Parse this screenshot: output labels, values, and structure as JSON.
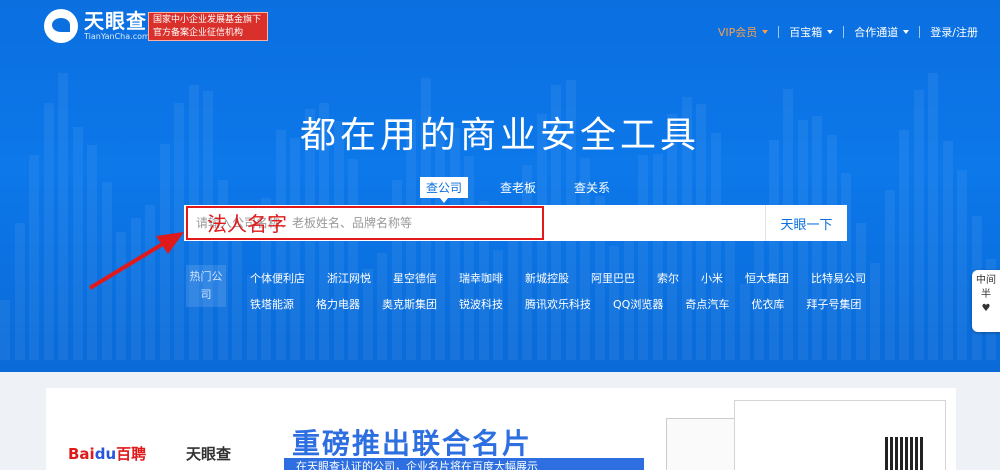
{
  "header": {
    "logo_cn": "天眼查",
    "logo_en": "TianYanCha.com",
    "badge_line1": "国家中小企业发展基金旗下",
    "badge_line2": "官方备案企业征信机构",
    "nav": [
      {
        "label": "VIP会员",
        "caret": true,
        "highlight": true
      },
      {
        "label": "百宝箱",
        "caret": true
      },
      {
        "label": "合作通道",
        "caret": true
      },
      {
        "label": "登录/注册",
        "caret": false
      }
    ]
  },
  "hero": {
    "headline": "都在用的商业安全工具",
    "tabs": [
      "查公司",
      "查老板",
      "查关系"
    ],
    "active_tab": 0,
    "search_placeholder": "请输入公司名称、老板姓名、品牌名称等",
    "search_button": "天眼一下",
    "annotation": "法人名字",
    "hot_label": "热门公司",
    "hot_rows": [
      [
        "个体便利店",
        "浙江网悦",
        "星空德信",
        "瑞幸咖啡",
        "新城控股",
        "阿里巴巴",
        "索尔",
        "小米",
        "恒大集团",
        "比特易公司"
      ],
      [
        "铁塔能源",
        "格力电器",
        "奥克斯集团",
        "锐波科技",
        "腾讯欢乐科技",
        "QQ浏览器",
        "奇点汽车",
        "优衣库",
        "拜子号集团"
      ]
    ],
    "side_tab": "中间半"
  },
  "banner": {
    "baidu_red": "Bai",
    "baidu_blue": "du",
    "baidu_suffix": "百聘",
    "tianyan": "天眼查",
    "title": "重磅推出联合名片",
    "subtitle": "在天眼查认证的公司，企业名片将在百度大幅展示"
  },
  "colors": {
    "brand": "#0b6fe0",
    "vip": "#f5a04d",
    "annotation": "#e0191a"
  }
}
